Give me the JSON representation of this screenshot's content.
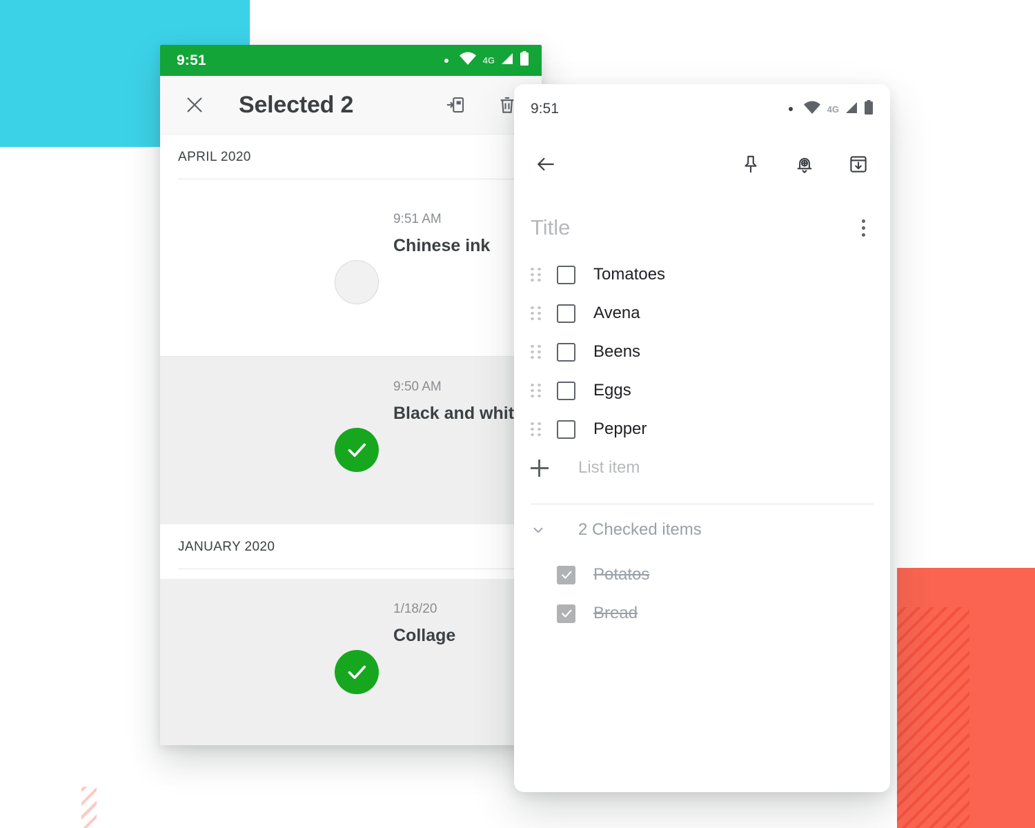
{
  "background": {
    "cyan_color": "#3bd2e8",
    "orange_color": "#fa6450",
    "page_color": "#ffffff"
  },
  "left_phone": {
    "status_bar": {
      "clock": "9:51",
      "network_label": "4G",
      "bar_color": "#13a538",
      "icons": [
        "dot-icon",
        "wifi-icon",
        "signal-icon",
        "battery-icon"
      ]
    },
    "toolbar": {
      "close_label": "close-icon",
      "title": "Selected 2",
      "actions": [
        {
          "name": "move-to-notebook-icon",
          "label": "Move to notebook"
        },
        {
          "name": "delete-icon",
          "label": "Delete"
        }
      ]
    },
    "sections": [
      {
        "header": "APRIL 2020",
        "notes": [
          {
            "time": "9:51 AM",
            "title": "Chinese ink",
            "selected": false,
            "thumbnail": "chinese-ink-wash-figure"
          },
          {
            "time": "9:50 AM",
            "title": "Black and white",
            "selected": true,
            "thumbnail": "black-ink-splatter-plants"
          }
        ]
      },
      {
        "header": "JANUARY 2020",
        "notes": [
          {
            "time": "1/18/20",
            "title": "Collage",
            "selected": true,
            "thumbnail": "orange-collage-portrait-butterfly"
          }
        ]
      }
    ],
    "selected_color": "#17a71f"
  },
  "right_phone": {
    "status_bar": {
      "clock": "9:51",
      "network_label": "4G",
      "icons": [
        "dot-icon",
        "wifi-icon",
        "signal-icon",
        "battery-icon"
      ]
    },
    "toolbar": {
      "back_label": "back-arrow-icon",
      "actions": [
        {
          "name": "pin-icon",
          "label": "Pin"
        },
        {
          "name": "reminder-bell-icon",
          "label": "Reminder"
        },
        {
          "name": "archive-icon",
          "label": "Archive"
        }
      ]
    },
    "note": {
      "title_placeholder": "Title",
      "title_value": "",
      "overflow_label": "more-options-icon",
      "items": [
        {
          "label": "Tomatoes",
          "checked": false
        },
        {
          "label": "Avena",
          "checked": false
        },
        {
          "label": "Beens",
          "checked": false
        },
        {
          "label": "Eggs",
          "checked": false
        },
        {
          "label": "Pepper",
          "checked": false
        }
      ],
      "add_item_placeholder": "List item",
      "checked_section_label": "2 Checked items",
      "checked_items": [
        {
          "label": "Potatos",
          "checked": true
        },
        {
          "label": "Bread",
          "checked": true
        }
      ]
    }
  }
}
